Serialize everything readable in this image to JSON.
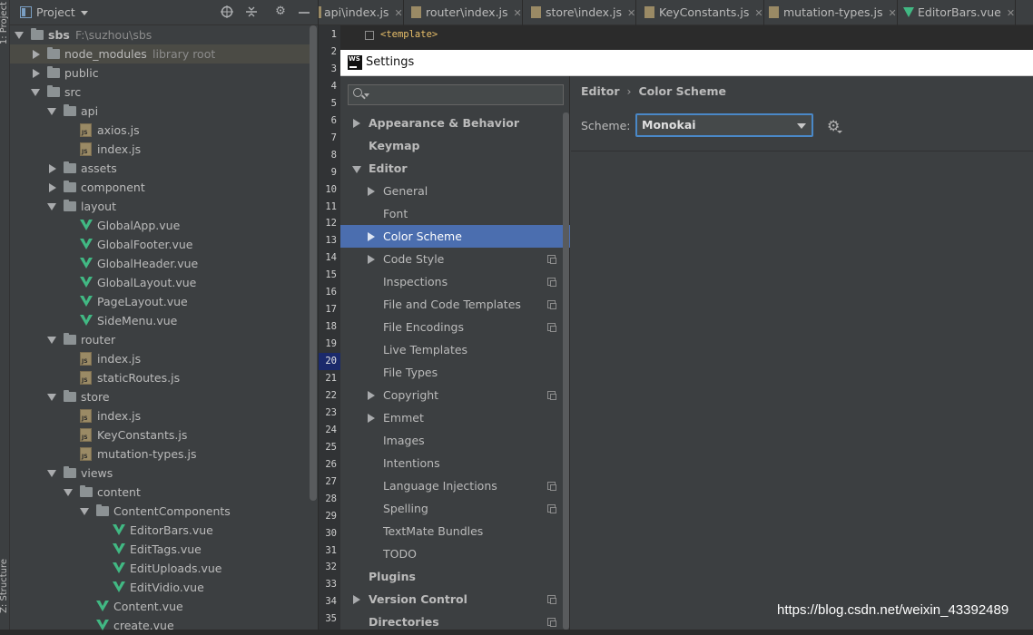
{
  "sidebar_stripe": {
    "project_label": "1: Project",
    "structure_label": "Z: Structure"
  },
  "project_panel": {
    "title": "Project",
    "tree": [
      {
        "label": "sbs",
        "hint": "F:\\suzhou\\sbs",
        "type": "folder",
        "depth": 0,
        "state": "open",
        "bold": true
      },
      {
        "label": "node_modules",
        "hint": "library root",
        "type": "folder",
        "depth": 1,
        "state": "closed",
        "selected": true
      },
      {
        "label": "public",
        "type": "folder",
        "depth": 1,
        "state": "closed"
      },
      {
        "label": "src",
        "type": "folder",
        "depth": 1,
        "state": "open"
      },
      {
        "label": "api",
        "type": "folder",
        "depth": 2,
        "state": "open"
      },
      {
        "label": "axios.js",
        "type": "js",
        "depth": 3
      },
      {
        "label": "index.js",
        "type": "js",
        "depth": 3
      },
      {
        "label": "assets",
        "type": "folder",
        "depth": 2,
        "state": "closed"
      },
      {
        "label": "component",
        "type": "folder",
        "depth": 2,
        "state": "closed"
      },
      {
        "label": "layout",
        "type": "folder",
        "depth": 2,
        "state": "open"
      },
      {
        "label": "GlobalApp.vue",
        "type": "vue",
        "depth": 3
      },
      {
        "label": "GlobalFooter.vue",
        "type": "vue",
        "depth": 3
      },
      {
        "label": "GlobalHeader.vue",
        "type": "vue",
        "depth": 3
      },
      {
        "label": "GlobalLayout.vue",
        "type": "vue",
        "depth": 3
      },
      {
        "label": "PageLayout.vue",
        "type": "vue",
        "depth": 3
      },
      {
        "label": "SideMenu.vue",
        "type": "vue",
        "depth": 3
      },
      {
        "label": "router",
        "type": "folder",
        "depth": 2,
        "state": "open"
      },
      {
        "label": "index.js",
        "type": "js",
        "depth": 3
      },
      {
        "label": "staticRoutes.js",
        "type": "js",
        "depth": 3
      },
      {
        "label": "store",
        "type": "folder",
        "depth": 2,
        "state": "open"
      },
      {
        "label": "index.js",
        "type": "js",
        "depth": 3
      },
      {
        "label": "KeyConstants.js",
        "type": "js",
        "depth": 3
      },
      {
        "label": "mutation-types.js",
        "type": "js",
        "depth": 3
      },
      {
        "label": "views",
        "type": "folder",
        "depth": 2,
        "state": "open"
      },
      {
        "label": "content",
        "type": "folder",
        "depth": 3,
        "state": "open"
      },
      {
        "label": "ContentComponents",
        "type": "folder",
        "depth": 4,
        "state": "open"
      },
      {
        "label": "EditorBars.vue",
        "type": "vue",
        "depth": 5
      },
      {
        "label": "EditTags.vue",
        "type": "vue",
        "depth": 5
      },
      {
        "label": "EditUploads.vue",
        "type": "vue",
        "depth": 5
      },
      {
        "label": "EditVidio.vue",
        "type": "vue",
        "depth": 5
      },
      {
        "label": "Content.vue",
        "type": "vue",
        "depth": 4
      },
      {
        "label": "create.vue",
        "type": "vue",
        "depth": 4
      }
    ]
  },
  "editor_tabs": [
    {
      "label": "api\\index.js",
      "type": "js",
      "active": true
    },
    {
      "label": "router\\index.js",
      "type": "js"
    },
    {
      "label": "store\\index.js",
      "type": "js"
    },
    {
      "label": "KeyConstants.js",
      "type": "js"
    },
    {
      "label": "mutation-types.js",
      "type": "js"
    },
    {
      "label": "EditorBars.vue",
      "type": "vue"
    }
  ],
  "gutter": {
    "lines": [
      "1",
      "2",
      "3",
      "4",
      "5",
      "6",
      "7",
      "8",
      "9",
      "10",
      "11",
      "12",
      "13",
      "14",
      "15",
      "16",
      "17",
      "18",
      "19",
      "20",
      "21",
      "22",
      "23",
      "24",
      "25",
      "26",
      "27",
      "28",
      "29",
      "30",
      "31",
      "32",
      "33",
      "34",
      "35"
    ],
    "current_line": "20"
  },
  "code_peek": {
    "line1": "<template>"
  },
  "settings": {
    "title": "Settings",
    "logo_text": "WS",
    "search": {
      "placeholder": ""
    },
    "nav": [
      {
        "label": "Appearance & Behavior",
        "indent": 0,
        "arrow": "right",
        "bold": true
      },
      {
        "label": "Keymap",
        "indent": 0,
        "bold": true
      },
      {
        "label": "Editor",
        "indent": 0,
        "arrow": "down",
        "bold": true
      },
      {
        "label": "General",
        "indent": 1,
        "arrow": "right"
      },
      {
        "label": "Font",
        "indent": 1
      },
      {
        "label": "Color Scheme",
        "indent": 1,
        "arrow": "right",
        "selected": true
      },
      {
        "label": "Code Style",
        "indent": 1,
        "arrow": "right",
        "copy": true
      },
      {
        "label": "Inspections",
        "indent": 1,
        "copy": true
      },
      {
        "label": "File and Code Templates",
        "indent": 1,
        "copy": true
      },
      {
        "label": "File Encodings",
        "indent": 1,
        "copy": true
      },
      {
        "label": "Live Templates",
        "indent": 1
      },
      {
        "label": "File Types",
        "indent": 1
      },
      {
        "label": "Copyright",
        "indent": 1,
        "arrow": "right",
        "copy": true
      },
      {
        "label": "Emmet",
        "indent": 1,
        "arrow": "right"
      },
      {
        "label": "Images",
        "indent": 1
      },
      {
        "label": "Intentions",
        "indent": 1
      },
      {
        "label": "Language Injections",
        "indent": 1,
        "copy": true
      },
      {
        "label": "Spelling",
        "indent": 1,
        "copy": true
      },
      {
        "label": "TextMate Bundles",
        "indent": 1
      },
      {
        "label": "TODO",
        "indent": 1
      },
      {
        "label": "Plugins",
        "indent": 0,
        "bold": true
      },
      {
        "label": "Version Control",
        "indent": 0,
        "arrow": "right",
        "bold": true,
        "copy": true
      },
      {
        "label": "Directories",
        "indent": 0,
        "bold": true,
        "copy": true
      }
    ],
    "breadcrumb": {
      "parent": "Editor",
      "separator": "›",
      "current": "Color Scheme"
    },
    "scheme": {
      "label": "Scheme:",
      "value": "Monokai"
    }
  },
  "watermark": "https://blog.csdn.net/weixin_43392489",
  "colors": {
    "selection": "#4b6eaf",
    "vue_green": "#41b883",
    "focus_border": "#4a88c7"
  }
}
